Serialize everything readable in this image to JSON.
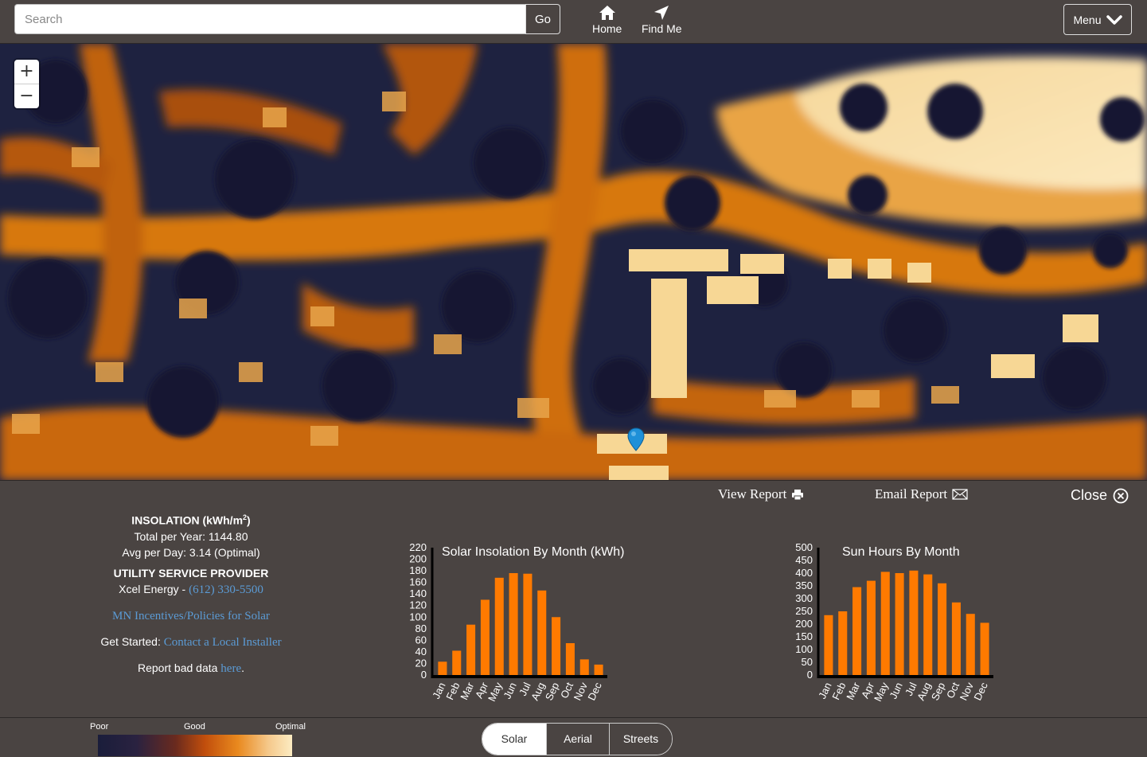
{
  "search": {
    "placeholder": "Search",
    "go_label": "Go"
  },
  "nav": {
    "home_label": "Home",
    "findme_label": "Find Me",
    "menu_label": "Menu"
  },
  "map": {
    "zoom_in": "+",
    "zoom_out": "−"
  },
  "report": {
    "view_label": "View Report",
    "email_label": "Email Report",
    "close_label": "Close"
  },
  "info": {
    "insolation_header": "INSOLATION (kWh/m",
    "insolation_sup": "2",
    "insolation_close": ")",
    "total_per_year": "Total per Year: 1144.80",
    "avg_per_day": "Avg per Day: 3.14 (Optimal)",
    "utility_header": "UTILITY SERVICE PROVIDER",
    "utility_name": "Xcel Energy - ",
    "utility_phone": "(612) 330-5500",
    "incentives_link": "MN Incentives/Policies for Solar",
    "get_started_label": "Get Started: ",
    "installer_link": "Contact a Local Installer",
    "report_bad_prefix": "Report bad data ",
    "report_bad_link": "here",
    "report_bad_suffix": "."
  },
  "chart_data": [
    {
      "type": "bar",
      "title": "Solar Insolation By Month (kWh)",
      "categories": [
        "Jan",
        "Feb",
        "Mar",
        "Apr",
        "May",
        "Jun",
        "Jul",
        "Aug",
        "Sep",
        "Oct",
        "Nov",
        "Dec"
      ],
      "values": [
        23,
        42,
        87,
        130,
        168,
        176,
        175,
        146,
        100,
        55,
        27,
        18
      ],
      "yticks": [
        0,
        20,
        40,
        60,
        80,
        100,
        120,
        140,
        160,
        180,
        200,
        220
      ],
      "ylim": [
        0,
        220
      ],
      "color": "#ff7a00"
    },
    {
      "type": "bar",
      "title": "Sun Hours By Month",
      "categories": [
        "Jan",
        "Feb",
        "Mar",
        "Apr",
        "May",
        "Jun",
        "Jul",
        "Aug",
        "Sep",
        "Oct",
        "Nov",
        "Dec"
      ],
      "values": [
        235,
        250,
        345,
        370,
        405,
        400,
        410,
        395,
        360,
        285,
        240,
        205
      ],
      "yticks": [
        0,
        50,
        100,
        150,
        200,
        250,
        300,
        350,
        400,
        450,
        500
      ],
      "ylim": [
        0,
        500
      ],
      "color": "#ff7a00"
    }
  ],
  "legend": {
    "poor": "Poor",
    "good": "Good",
    "optimal": "Optimal"
  },
  "layers": {
    "solar": "Solar",
    "aerial": "Aerial",
    "streets": "Streets"
  }
}
